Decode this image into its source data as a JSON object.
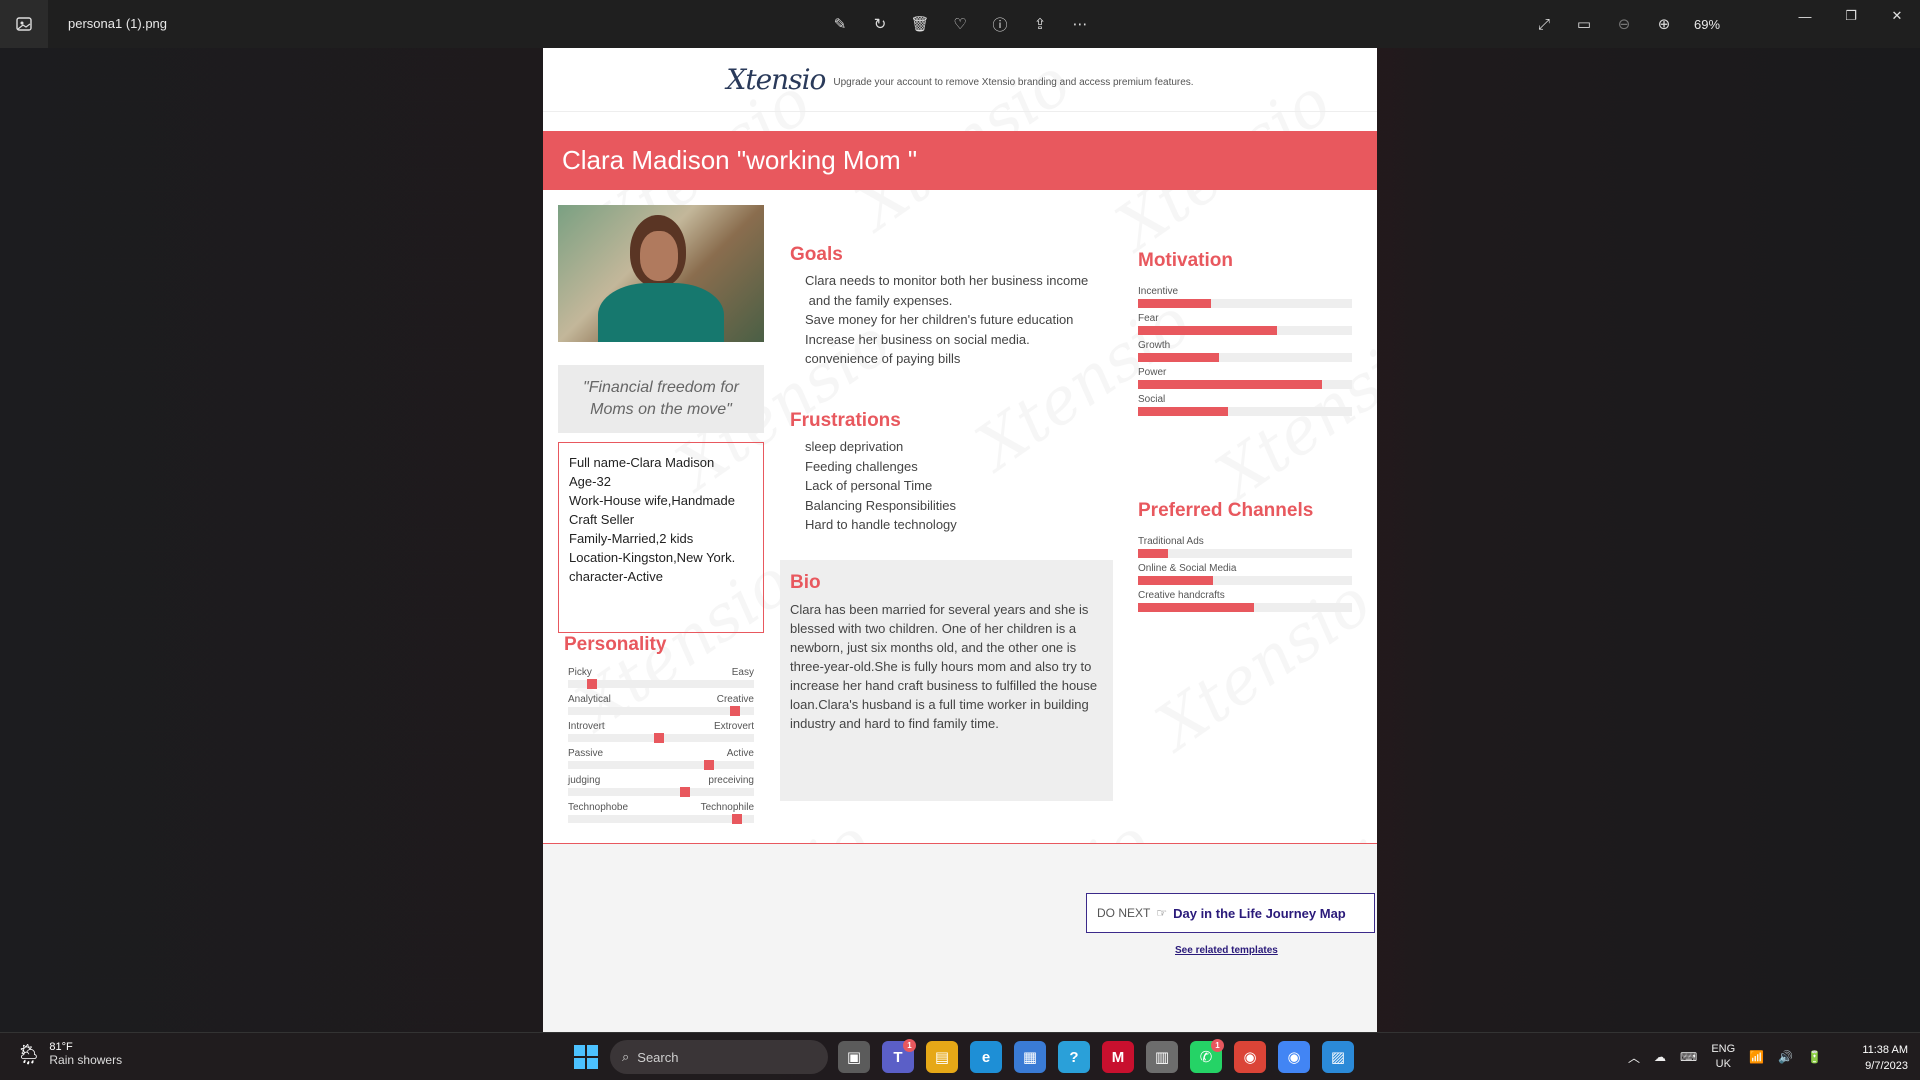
{
  "window": {
    "filename": "persona1 (1).png",
    "zoom": "69%"
  },
  "toolbar": {
    "tools": [
      "edit-icon",
      "rotate-icon",
      "delete-icon",
      "favorite-icon",
      "info-icon",
      "share-icon",
      "more-icon"
    ],
    "right_tools": [
      "fullscreen-icon",
      "actual-size-icon",
      "zoom-out-icon",
      "zoom-in-icon"
    ]
  },
  "doc": {
    "brand": {
      "logo": "Xtensio",
      "note": "Upgrade your account to remove Xtensio branding and access premium features."
    },
    "title": "Clara Madison \"working Mom \"",
    "quote": "\"Financial freedom for Moms on the move\"",
    "info": [
      "Full name-Clara Madison",
      "Age-32",
      "Work-House wife,Handmade Craft Seller",
      "Family-Married,2 kids",
      "Location-Kingston,New York.",
      "character-Active"
    ],
    "personality": {
      "title": "Personality",
      "sliders": [
        {
          "left": "Picky",
          "right": "Easy",
          "value": 0.13
        },
        {
          "left": "Analytical",
          "right": "Creative",
          "value": 0.9
        },
        {
          "left": "Introvert",
          "right": "Extrovert",
          "value": 0.49
        },
        {
          "left": "Passive",
          "right": "Active",
          "value": 0.76
        },
        {
          "left": "judging",
          "right": "preceiving",
          "value": 0.63
        },
        {
          "left": "Technophobe",
          "right": "Technophile",
          "value": 0.91
        }
      ]
    },
    "goals": {
      "title": "Goals",
      "items": [
        "Clara needs to monitor both her business income",
        " and the family expenses.",
        "Save money for her children's future education",
        "Increase her business on social media.",
        "convenience of paying bills"
      ]
    },
    "frustrations": {
      "title": "Frustrations",
      "items": [
        "sleep deprivation",
        "Feeding challenges",
        "Lack of personal Time",
        "Balancing Responsibilities",
        "Hard to handle technology"
      ]
    },
    "bio": {
      "title": "Bio",
      "text": "Clara has been married for several years and she  is  blessed with two children. One of her children is a newborn, just six months old, and the other one is  three-year-old.She is fully hours mom and also try to increase her hand craft business to fulfilled the house loan.Clara's husband is a full time worker in building industry and hard to find family time."
    },
    "motivation": {
      "title": "Motivation",
      "bars": [
        {
          "label": "Incentive",
          "value": 0.34
        },
        {
          "label": "Fear",
          "value": 0.65
        },
        {
          "label": "Growth",
          "value": 0.38
        },
        {
          "label": "Power",
          "value": 0.86
        },
        {
          "label": "Social",
          "value": 0.42
        }
      ]
    },
    "channels": {
      "title": "Preferred Channels",
      "bars": [
        {
          "label": "Traditional Ads",
          "value": 0.14
        },
        {
          "label": "Online & Social Media",
          "value": 0.35
        },
        {
          "label": "Creative handcrafts",
          "value": 0.54
        }
      ]
    },
    "footer": {
      "do_next_prefix": "DO NEXT",
      "do_next_link": "Day in the Life Journey Map",
      "related": "See related templates"
    }
  },
  "taskbar": {
    "weather_temp": "81°F",
    "weather_cond": "Rain showers",
    "search_placeholder": "Search",
    "lang_top": "ENG",
    "lang_bottom": "UK",
    "time": "11:38 AM",
    "date": "9/7/2023",
    "apps": [
      {
        "name": "task-view-icon",
        "color": "#5b5b5b",
        "badge": ""
      },
      {
        "name": "teams-icon",
        "color": "#5b5fc7",
        "badge": "1"
      },
      {
        "name": "file-explorer-icon",
        "color": "#e6a817",
        "badge": ""
      },
      {
        "name": "edge-icon",
        "color": "#1e8fd6",
        "badge": ""
      },
      {
        "name": "store-icon",
        "color": "#3a7bd5",
        "badge": ""
      },
      {
        "name": "help-icon",
        "color": "#2aa0d9",
        "badge": ""
      },
      {
        "name": "mcafee-icon",
        "color": "#c8102e",
        "badge": ""
      },
      {
        "name": "files-icon",
        "color": "#6d6d6d",
        "badge": ""
      },
      {
        "name": "whatsapp-icon",
        "color": "#25d366",
        "badge": "1"
      },
      {
        "name": "chrome-icon",
        "color": "#db4437",
        "badge": ""
      },
      {
        "name": "chrome-profile-icon",
        "color": "#4285f4",
        "badge": ""
      },
      {
        "name": "photos-icon",
        "color": "#2b8ad8",
        "badge": ""
      }
    ]
  }
}
